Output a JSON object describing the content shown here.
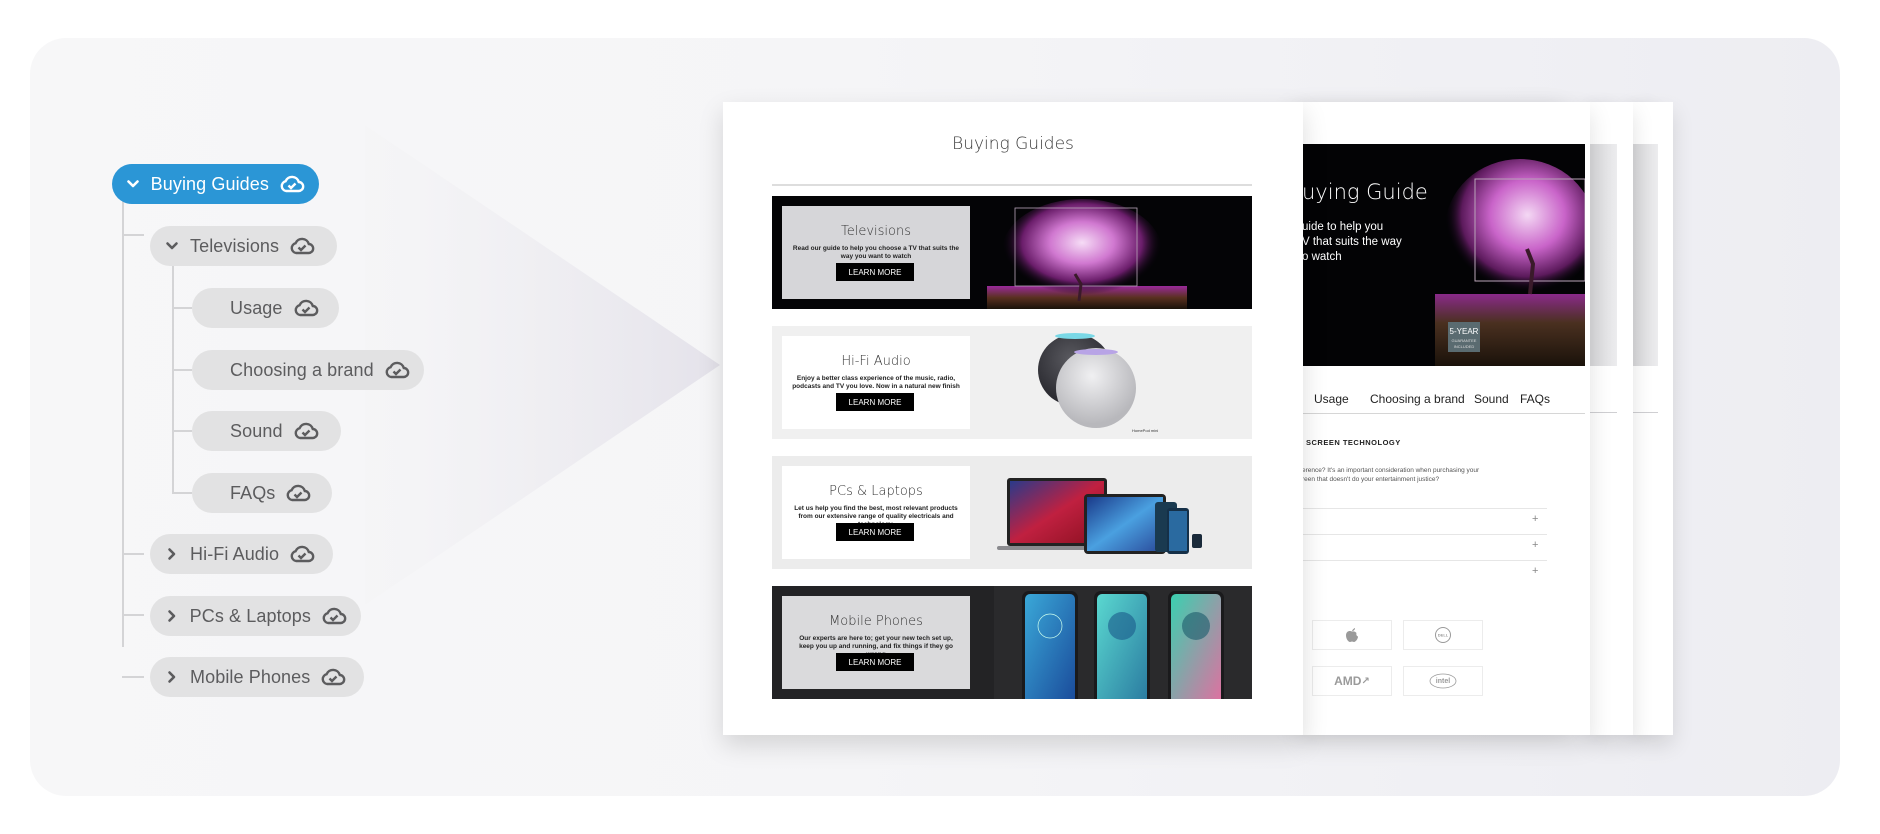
{
  "colors": {
    "accent": "#2b96d6",
    "node_bg": "#e2e2e3",
    "node_text": "#5c5c5e"
  },
  "tree": {
    "root": {
      "label": "Buying Guides",
      "expanded": true,
      "icon": "cloud-check-icon"
    },
    "children": [
      {
        "label": "Televisions",
        "expanded": true,
        "icon": "cloud-check-icon",
        "children": [
          {
            "label": "Usage",
            "icon": "cloud-check-icon"
          },
          {
            "label": "Choosing a brand",
            "icon": "cloud-check-icon"
          },
          {
            "label": "Sound",
            "icon": "cloud-check-icon"
          },
          {
            "label": "FAQs",
            "icon": "cloud-check-icon"
          }
        ]
      },
      {
        "label": "Hi-Fi Audio",
        "expanded": false,
        "icon": "cloud-check-icon"
      },
      {
        "label": "PCs & Laptops",
        "expanded": false,
        "icon": "cloud-check-icon"
      },
      {
        "label": "Mobile Phones",
        "expanded": false,
        "icon": "cloud-check-icon"
      }
    ]
  },
  "front_page": {
    "title": "Buying Guides",
    "banners": [
      {
        "heading": "Televisions",
        "text": "Read our guide to help you choose a TV that suits the way you want to watch",
        "button": "LEARN MORE",
        "image": "oled-tv-tree"
      },
      {
        "heading": "Hi-Fi Audio",
        "text": "Enjoy a better class experience of the music, radio, podcasts and TV you love. Now in a natural new finish",
        "button": "LEARN MORE",
        "image": "homepod-mini",
        "caption": "HomePod mini"
      },
      {
        "heading": "PCs & Laptops",
        "text": "Let us help you find the best, most relevant products from our extensive range of quality electricals and technology.",
        "button": "LEARN MORE",
        "image": "apple-devices"
      },
      {
        "heading": "Mobile Phones",
        "text": "Our experts are here to; get your new tech set up, keep you up and running, and fix things if they go wrong",
        "button": "LEARN MORE",
        "image": "moto-phones"
      }
    ]
  },
  "second_page": {
    "hero_title": "uying Guide",
    "hero_text": [
      "uide to help you",
      "V that suits the way",
      "o watch"
    ],
    "badge": [
      "5-YEAR",
      "GUARANTEE",
      "INCLUDED"
    ],
    "tabs": [
      "Usage",
      "Choosing a brand",
      "Sound",
      "FAQs"
    ],
    "section_heading": "SCREEN TECHNOLOGY",
    "section_text": [
      "erence? It's an important consideration when purchasing your",
      "reen that doesn't do your entertainment justice?"
    ],
    "accordion": [
      "+",
      "+",
      "+"
    ],
    "brands": [
      "apple",
      "DELL",
      "AMD",
      "intel"
    ]
  }
}
